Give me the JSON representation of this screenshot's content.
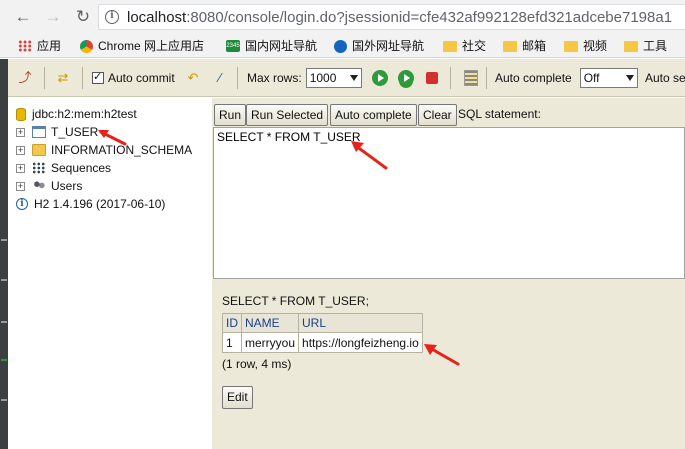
{
  "browser": {
    "url_host": "localhost",
    "url_rest": ":8080/console/login.do?jsessionid=cfe432af992128efd321adcebe7198a1",
    "bookmarks": [
      {
        "label": "应用",
        "icon": "apps-icon"
      },
      {
        "label": "Chrome 网上应用店",
        "icon": "chrome-store-icon"
      },
      {
        "label": "国内网址导航",
        "icon": "2345-icon"
      },
      {
        "label": "国外网址导航",
        "icon": "globe-icon"
      },
      {
        "label": "社交",
        "icon": "folder-icon"
      },
      {
        "label": "邮箱",
        "icon": "folder-icon"
      },
      {
        "label": "视频",
        "icon": "folder-icon"
      },
      {
        "label": "工具",
        "icon": "folder-icon"
      }
    ]
  },
  "toolbar": {
    "auto_commit_label": "Auto commit",
    "auto_commit_checked": true,
    "max_rows_label": "Max rows:",
    "max_rows_value": "1000",
    "auto_complete_label": "Auto complete",
    "auto_complete_value": "Off",
    "auto_select_label": "Auto se"
  },
  "tree": {
    "connection": "jdbc:h2:mem:h2test",
    "items": [
      {
        "label": "T_USER",
        "icon": "table-icon"
      },
      {
        "label": "INFORMATION_SCHEMA",
        "icon": "folder-icon"
      },
      {
        "label": "Sequences",
        "icon": "sequences-icon"
      },
      {
        "label": "Users",
        "icon": "users-icon"
      }
    ],
    "version": "H2 1.4.196 (2017-06-10)"
  },
  "query": {
    "buttons": {
      "run": "Run",
      "run_selected": "Run Selected",
      "auto_complete": "Auto complete",
      "clear": "Clear"
    },
    "sql_label": "SQL statement:",
    "sql_text": "SELECT * FROM T_USER"
  },
  "result": {
    "sql": "SELECT * FROM T_USER;",
    "columns": [
      "ID",
      "NAME",
      "URL"
    ],
    "rows": [
      [
        "1",
        "merryyou",
        "https://longfeizheng.io"
      ]
    ],
    "summary": "(1 row, 4 ms)",
    "edit_label": "Edit"
  },
  "colors": {
    "panel_bg": "#ece9d8",
    "header_link": "#1a3f8c",
    "annotation_arrow": "#e8221b"
  }
}
